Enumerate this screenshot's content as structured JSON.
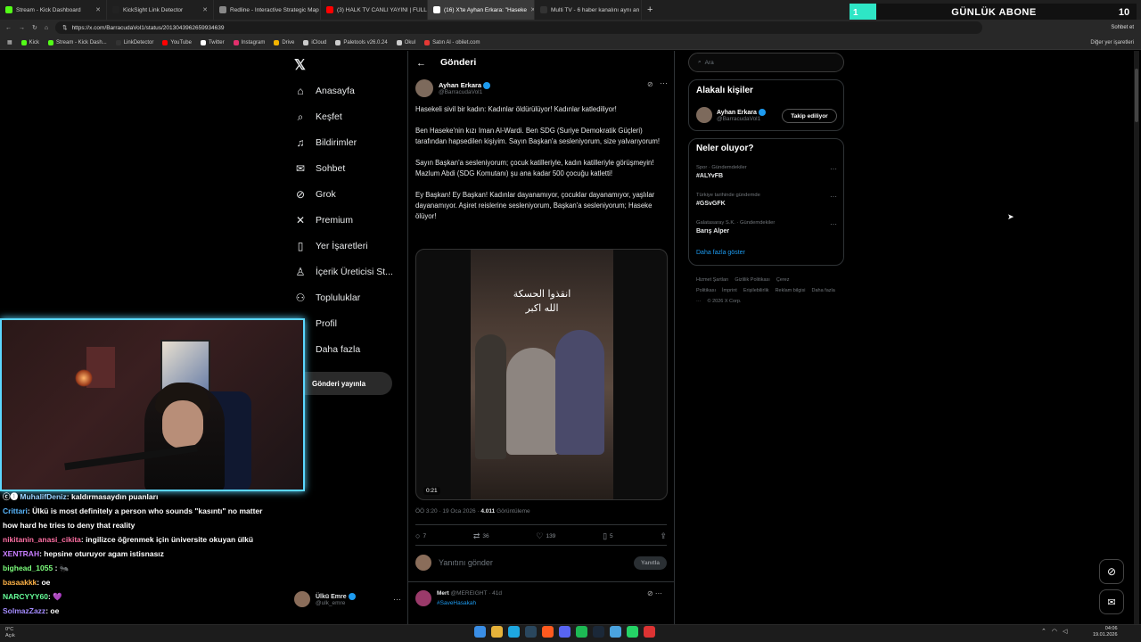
{
  "browser": {
    "tabs": [
      {
        "label": "Stream - Kick Dashboard",
        "color": "#53fc18",
        "active": false
      },
      {
        "label": "KickSight Link Detector",
        "color": "#222222",
        "active": false
      },
      {
        "label": "Redline - Interactive Strategic Map",
        "color": "#888888",
        "active": false
      },
      {
        "label": "(3) HALK TV CANLI YAYINI | FULL",
        "color": "#ff0000",
        "active": false
      },
      {
        "label": "(16) X'te Ayhan Erkara: \"Haseke",
        "color": "#ffffff",
        "active": true
      },
      {
        "label": "Multi TV - 6 haber kanalını aynı an",
        "color": "#333333",
        "active": false
      }
    ],
    "url": "https://x.com/BarracudaVol1/status/2013043962659934639",
    "sohbet_label": "Sohbet et",
    "bookmarks": [
      {
        "label": "Kick",
        "color": "#53fc18"
      },
      {
        "label": "Stream - Kick Dash...",
        "color": "#53fc18"
      },
      {
        "label": "LinkDetector",
        "color": "#333333"
      },
      {
        "label": "YouTube",
        "color": "#ff0000"
      },
      {
        "label": "Twitter",
        "color": "#ffffff"
      },
      {
        "label": "Instagram",
        "color": "#e1306c"
      },
      {
        "label": "Drive",
        "color": "#f4b400"
      },
      {
        "label": "iCloud",
        "color": "#cccccc"
      },
      {
        "label": "Paletools v26.0.24",
        "color": "#cccccc"
      },
      {
        "label": "Okul",
        "color": "#cccccc"
      },
      {
        "label": "Satın Al - obilet.com",
        "color": "#e53935"
      }
    ],
    "other_bookmarks": "Diğer yer işaretleri"
  },
  "overlay": {
    "sub_count": "1",
    "sub_label": "GÜNLÜK ABONE",
    "sub_goal": "10"
  },
  "sidebar": {
    "items": [
      {
        "label": "Anasayfa",
        "icon": "home-icon",
        "glyph": "⌂"
      },
      {
        "label": "Keşfet",
        "icon": "search-icon",
        "glyph": "⌕"
      },
      {
        "label": "Bildirimler",
        "icon": "bell-icon",
        "glyph": "♫"
      },
      {
        "label": "Sohbet",
        "icon": "mail-icon",
        "glyph": "✉"
      },
      {
        "label": "Grok",
        "icon": "grok-icon",
        "glyph": "⊘"
      },
      {
        "label": "Premium",
        "icon": "x-icon",
        "glyph": "✕"
      },
      {
        "label": "Yer İşaretleri",
        "icon": "bookmark-icon",
        "glyph": "▯"
      },
      {
        "label": "İçerik Üreticisi St...",
        "icon": "creator-icon",
        "glyph": "♙"
      },
      {
        "label": "Topluluklar",
        "icon": "communities-icon",
        "glyph": "⚇"
      },
      {
        "label": "Profil",
        "icon": "profile-icon",
        "glyph": "♙"
      },
      {
        "label": "Daha fazla",
        "icon": "more-icon",
        "glyph": "⋯"
      }
    ],
    "notif_badge": "16",
    "post_button": "Gönderi yayınla",
    "profile": {
      "name": "Ülkü Emre",
      "handle": "@ulk_emre"
    }
  },
  "main": {
    "title": "Gönderi",
    "tweet": {
      "author_name": "Ayhan Erkara",
      "author_handle": "@BarracudaVol1",
      "paragraphs": [
        "Hasekeli sivil bir kadın: Kadınlar öldürülüyor! Kadınlar katlediliyor!",
        "Ben Haseke'nin kızı Iman Al-Wardi. Ben SDG (Suriye Demokratik Güçleri) tarafından hapsedilen kişiyim. Sayın Başkan'a sesleniyorum, size yalvarıyorum!",
        "Sayın Başkan'a sesleniyorum; çocuk katilleriyle, kadın katilleriyle görüşmeyin! Mazlum Abdi (SDG Komutanı) şu ana kadar 500 çocuğu katletti!",
        "Ey Başkan! Ey Başkan! Kadınlar dayanamıyor, çocuklar dayanamıyor, yaşlılar dayanamıyor. Aşiret reislerine sesleniyorum, Başkan'a sesleniyorum; Haseke ölüyor!"
      ],
      "video_overlay_line1": "انقذوا الحسكة",
      "video_overlay_line2": "الله اكبر",
      "video_time": "0:21",
      "time": "ÖÖ 3:20 · 19 Oca 2026 · ",
      "views": "4.011",
      "views_label": " Görüntüleme",
      "replies": "7",
      "reposts": "36",
      "likes": "139",
      "bookmarks": "5"
    },
    "reply_placeholder": "Yanıtını gönder",
    "reply_button": "Yanıtla",
    "reply2": {
      "name": "Mert",
      "handle": "@MEREIGHT · 41d",
      "tag": "#SaveHasakah"
    }
  },
  "right": {
    "search_placeholder": "Ara",
    "related_title": "Alakalı kişiler",
    "related_user": {
      "name": "Ayhan Erkara",
      "handle": "@BarracudaVol1"
    },
    "follow_button": "Takip ediliyor",
    "trends_title": "Neler oluyor?",
    "trends": [
      {
        "context": "Spor · Gündemdekiler",
        "topic": "#ALYvFB"
      },
      {
        "context": "Türkiye tarihinde gündemde",
        "topic": "#GSvGFK"
      },
      {
        "context": "Galatasaray S.K. · Gündemdekiler",
        "topic": "Barış Alper"
      }
    ],
    "show_more": "Daha fazla göster",
    "footer": [
      "Hizmet Şartları",
      "Gizlilik Politikası",
      "Çerez Politikası",
      "İmprint",
      "Erişilebilirlik",
      "Reklam bilgisi",
      "Daha fazla ···",
      "© 2026 X Corp."
    ]
  },
  "chat": [
    {
      "user": "MuhalifDeniz",
      "color": "#9bd3ff",
      "msg": ": kaldırmasaydın puanları",
      "badge": "ⓒ➊ "
    },
    {
      "user": "Crittari",
      "color": "#5ab8ff",
      "msg": ": Ülkü is most definitely a person who sounds \"kasıntı\" no matter how hard he tries to deny that reality",
      "badge": ""
    },
    {
      "user": "nikitanin_anasi_cikita",
      "color": "#ff6fa3",
      "msg": ": ingilizce öğrenmek için üniversite okuyan ülkü",
      "badge": ""
    },
    {
      "user": "XENTRAH",
      "color": "#c77dff",
      "msg": ": hepsine oturuyor agam istisnasız",
      "badge": ""
    },
    {
      "user": "bighead_1055",
      "color": "#7cff7c",
      "msg": " : 🐜",
      "badge": ""
    },
    {
      "user": "basaakkk",
      "color": "#ffb347",
      "msg": ": oe",
      "badge": ""
    },
    {
      "user": "NARCYYY60",
      "color": "#66ff99",
      "msg": ": 💜",
      "badge": ""
    },
    {
      "user": "SolmazZazz",
      "color": "#a58cff",
      "msg": ": oe",
      "badge": ""
    }
  ],
  "taskbar": {
    "weather_temp": "0°C",
    "weather_text": "Açık",
    "time": "04:06",
    "date": "19.01.2026"
  }
}
